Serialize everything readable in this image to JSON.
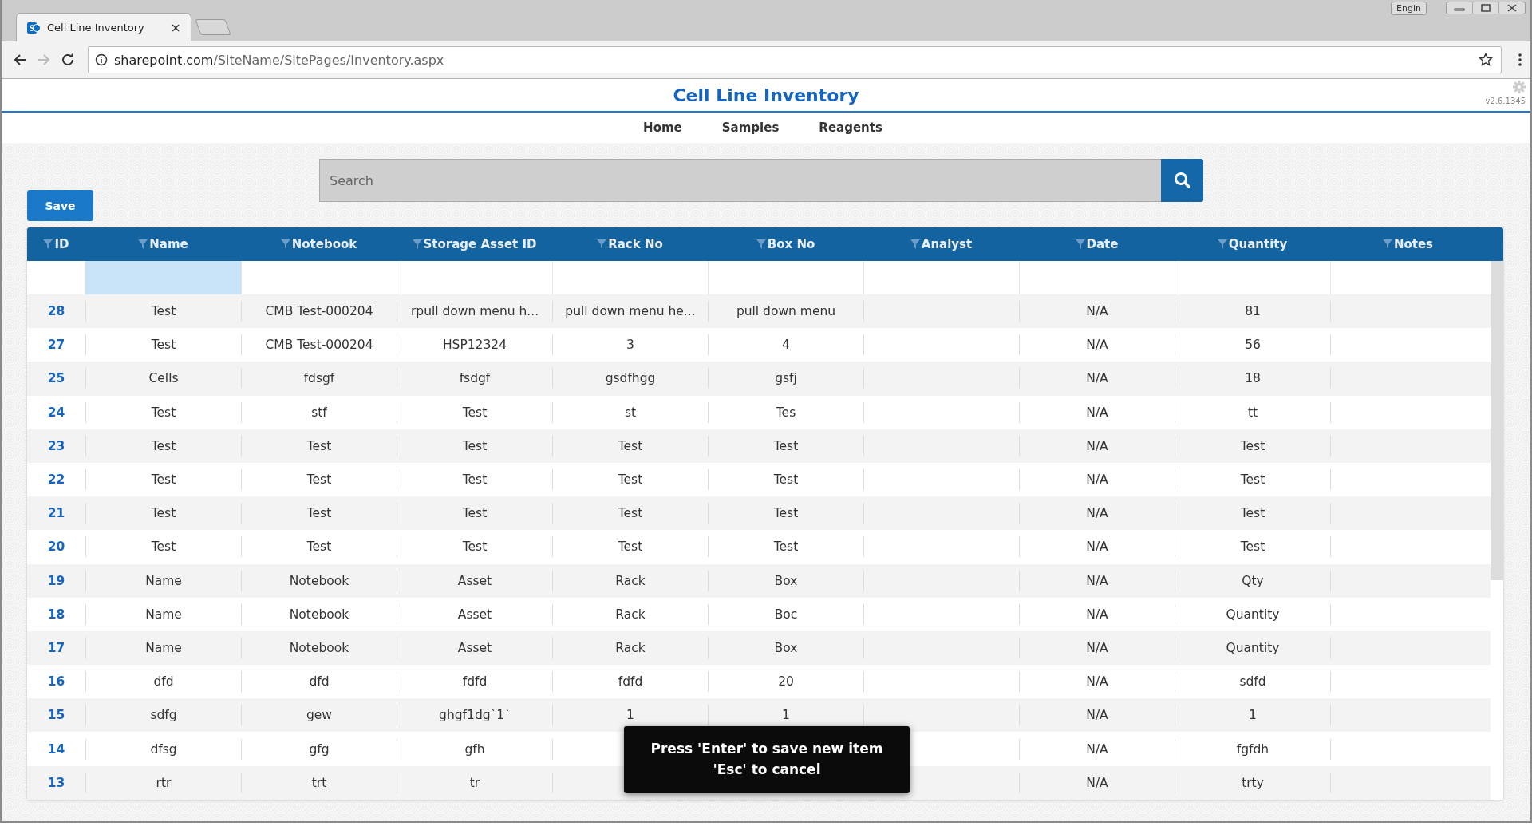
{
  "browser": {
    "tab_title": "Cell Line Inventory",
    "tab_close": "×",
    "url_host": "sharepoint.com",
    "url_path": "/SiteName/SitePages/Inventory.aspx",
    "ime_label": "Engin"
  },
  "app": {
    "title": "Cell Line Inventory",
    "version": "v2.6.1345",
    "nav": [
      "Home",
      "Samples",
      "Reagents"
    ]
  },
  "search": {
    "placeholder": "Search"
  },
  "save_button": "Save",
  "table": {
    "columns": [
      "ID",
      "Name",
      "Notebook",
      "Storage Asset ID",
      "Rack No",
      "Box No",
      "Analyst",
      "Date",
      "Quantity",
      "Notes"
    ],
    "new_row": [
      {
        "selected": true
      },
      {
        "selected": false
      },
      {
        "selected": false
      },
      {
        "selected": false
      },
      {
        "selected": false
      },
      {
        "selected": false
      },
      {
        "selected": false
      },
      {
        "selected": false
      },
      {
        "selected": false
      }
    ],
    "rows": [
      [
        "28",
        "Test",
        "CMB Test-000204",
        "rpull down menu h...",
        "pull down menu he...",
        "pull down menu",
        null,
        "N/A",
        "81",
        null
      ],
      [
        "27",
        "Test",
        "CMB Test-000204",
        "HSP12324",
        "3",
        "4",
        null,
        "N/A",
        "56",
        null
      ],
      [
        "25",
        "Cells",
        "fdsgf",
        "fsdgf",
        "gsdfhgg",
        "gsfj",
        null,
        "N/A",
        "18",
        null
      ],
      [
        "24",
        "Test",
        "stf",
        "Test",
        "st",
        "Tes",
        null,
        "N/A",
        "tt",
        null
      ],
      [
        "23",
        "Test",
        "Test",
        "Test",
        "Test",
        "Test",
        null,
        "N/A",
        "Test",
        null
      ],
      [
        "22",
        "Test",
        "Test",
        "Test",
        "Test",
        "Test",
        null,
        "N/A",
        "Test",
        null
      ],
      [
        "21",
        "Test",
        "Test",
        "Test",
        "Test",
        "Test",
        null,
        "N/A",
        "Test",
        null
      ],
      [
        "20",
        "Test",
        "Test",
        "Test",
        "Test",
        "Test",
        null,
        "N/A",
        "Test",
        null
      ],
      [
        "19",
        "Name",
        "Notebook",
        "Asset",
        "Rack",
        "Box",
        null,
        "N/A",
        "Qty",
        null
      ],
      [
        "18",
        "Name",
        "Notebook",
        "Asset",
        "Rack",
        "Boc",
        null,
        "N/A",
        "Quantity",
        null
      ],
      [
        "17",
        "Name",
        "Notebook",
        "Asset",
        "Rack",
        "Box",
        null,
        "N/A",
        "Quantity",
        null
      ],
      [
        "16",
        "dfd",
        "dfd",
        "fdfd",
        "fdfd",
        "20",
        null,
        "N/A",
        "sdfd",
        null
      ],
      [
        "15",
        "sdfg",
        "gew",
        "ghgf1dg`1`",
        "1",
        "1",
        null,
        "N/A",
        "1",
        null
      ],
      [
        "14",
        "dfsg",
        "gfg",
        "gfh",
        null,
        null,
        null,
        "N/A",
        "fgfdh",
        null
      ],
      [
        "13",
        "rtr",
        "trt",
        "tr",
        null,
        null,
        null,
        "N/A",
        "trty",
        null
      ]
    ]
  },
  "tooltip": {
    "lines": [
      "Press 'Enter' to save new item",
      "'Esc' to cancel"
    ]
  }
}
